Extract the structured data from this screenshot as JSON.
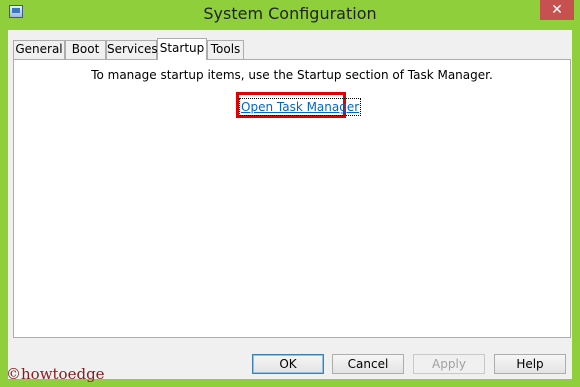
{
  "window": {
    "title": "System Configuration",
    "close_glyph": "✕",
    "icon": "msconfig-app-icon"
  },
  "tabs": [
    {
      "label": "General",
      "active": false
    },
    {
      "label": "Boot",
      "active": false
    },
    {
      "label": "Services",
      "active": false
    },
    {
      "label": "Startup",
      "active": true
    },
    {
      "label": "Tools",
      "active": false
    }
  ],
  "startup_panel": {
    "message": "To manage startup items, use the Startup section of Task Manager.",
    "link_label": "Open Task Manager",
    "highlight_color": "#e00000"
  },
  "buttons": {
    "ok": "OK",
    "cancel": "Cancel",
    "apply": "Apply",
    "help": "Help"
  },
  "watermark": "©howtoedge",
  "colors": {
    "frame": "#8fcf3c",
    "close_button": "#c75050",
    "link": "#0066cc"
  }
}
